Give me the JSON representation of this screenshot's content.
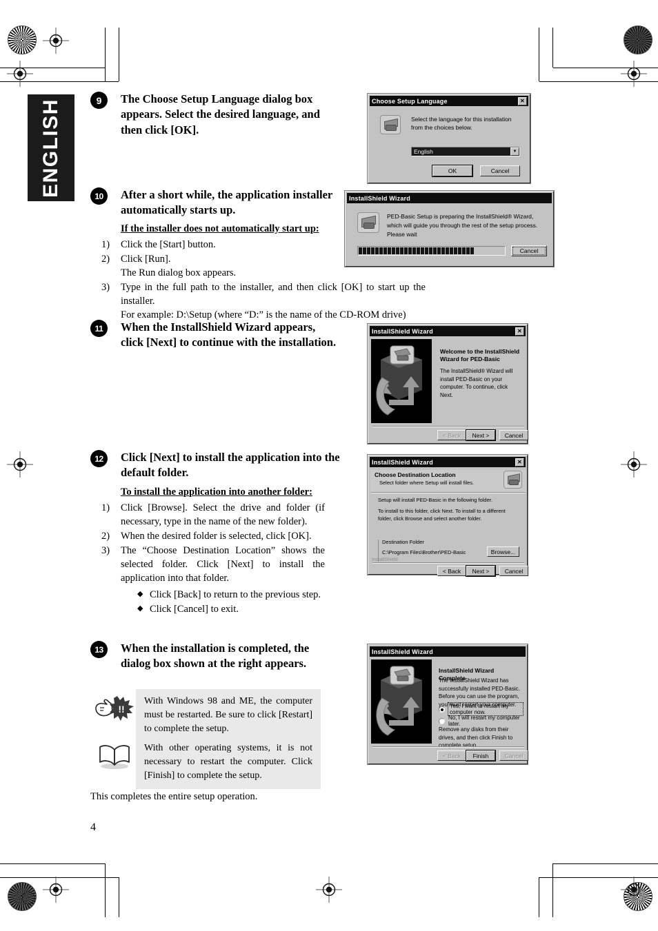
{
  "page": {
    "language_tab": "ENGLISH",
    "page_number": "4",
    "closing_text": "This completes the entire setup operation."
  },
  "steps": [
    {
      "number": "9",
      "title": "The Choose Setup Language dialog box appears. Select the desired language, and then click [OK]."
    },
    {
      "number": "10",
      "title": "After a short while, the application installer automatically starts up.",
      "subhead": "If the installer does not automatically start up:",
      "items": [
        {
          "marker": "1)",
          "lines": [
            "Click the [Start] button."
          ]
        },
        {
          "marker": "2)",
          "lines": [
            "Click [Run].",
            "The Run dialog box appears."
          ]
        },
        {
          "marker": "3)",
          "lines": [
            "Type in the full path to the installer, and then click [OK] to start up the installer.",
            "For example: D:\\Setup (where “D:” is the name of the CD-ROM drive)"
          ]
        }
      ]
    },
    {
      "number": "11",
      "title": "When the InstallShield Wizard appears, click [Next] to continue with the installation."
    },
    {
      "number": "12",
      "title": "Click [Next] to install the application into the default folder.",
      "subhead": "To install the application into another folder:",
      "items": [
        {
          "marker": "1)",
          "lines": [
            "Click [Browse]. Select the drive and folder (if necessary, type in the name of the new folder)."
          ]
        },
        {
          "marker": "2)",
          "lines": [
            "When the desired folder is selected, click [OK]."
          ]
        },
        {
          "marker": "3)",
          "lines": [
            "The “Choose Destination Location” shows the selected folder. Click [Next] to install the application into that folder."
          ]
        }
      ],
      "bullets": [
        "Click [Back] to return to the previous step.",
        "Click [Cancel] to exit."
      ]
    },
    {
      "number": "13",
      "title": "When the installation is completed, the dialog box shown at the right appears."
    }
  ],
  "notes": [
    {
      "icon": "caution-hand-icon",
      "text": "With Windows 98 and ME, the computer must be restarted. Be sure to click [Restart] to complete the setup."
    },
    {
      "icon": "open-book-icon",
      "text": "With other operating systems, it is not necessary to restart the computer. Click [Finish] to complete the setup."
    }
  ],
  "dialogs": {
    "choose_language": {
      "title": "Choose Setup Language",
      "close_glyph": "✕",
      "message": "Select the language for this installation from the choices below.",
      "selected_language": "English",
      "ok_label": "OK",
      "cancel_label": "Cancel"
    },
    "preparing": {
      "title": "InstallShield Wizard",
      "message": "PED-Basic Setup is preparing the InstallShield® Wizard, which will guide you through the rest of the setup process. Please wait",
      "progress_percent": 78,
      "cancel_label": "Cancel"
    },
    "welcome": {
      "title": "InstallShield Wizard",
      "close_glyph": "✕",
      "heading": "Welcome to the InstallShield Wizard for PED-Basic",
      "body": "The InstallShield® Wizard will install PED-Basic on your computer.  To continue, click Next.",
      "back_label": "< Back",
      "next_label": "Next >",
      "cancel_label": "Cancel"
    },
    "destination": {
      "title": "InstallShield Wizard",
      "close_glyph": "✕",
      "heading": "Choose Destination Location",
      "subheading": "Select folder where Setup will install files.",
      "body_line1": "Setup will install PED-Basic in the following folder.",
      "body_line2": "To install to this folder, click Next. To install to a different folder, click Browse and select another folder.",
      "group_label": "Destination Folder",
      "path": "C:\\Program Files\\Brother\\PED-Basic",
      "browse_label": "Browse...",
      "footer_brand": "InstallShield",
      "back_label": "< Back",
      "next_label": "Next >",
      "cancel_label": "Cancel"
    },
    "complete": {
      "title": "InstallShield Wizard",
      "heading": "InstallShield Wizard Complete",
      "body": "The InstallShield Wizard has successfully installed PED-Basic. Before you can use the program, you must restart your computer.",
      "radio_yes": "Yes, I want to restart my computer now.",
      "radio_no": "No, I will restart my computer later.",
      "footer": "Remove any disks from their drives, and then click Finish to complete setup.",
      "back_label": "< Back",
      "finish_label": "Finish",
      "cancel_label": "Cancel"
    }
  }
}
